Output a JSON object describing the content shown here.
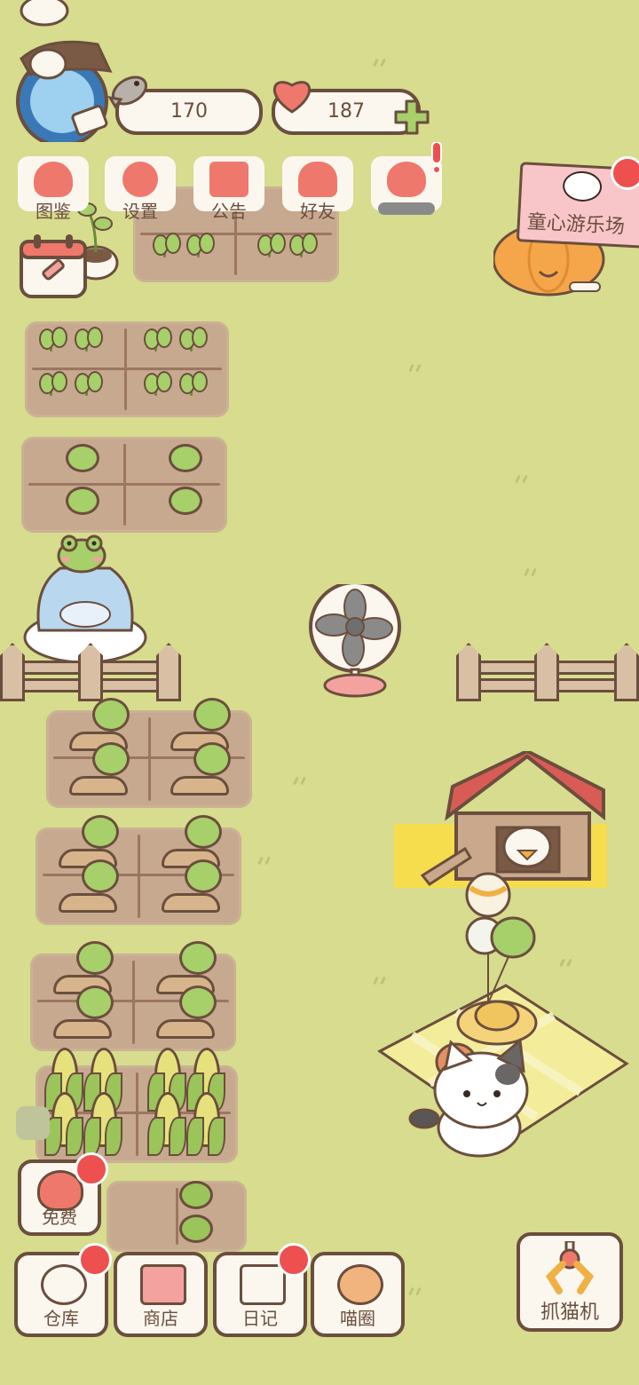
{
  "resources": {
    "fish_count": "170",
    "heart_count": "187"
  },
  "menu": [
    {
      "label": "图鉴",
      "icon": "cat-book-icon"
    },
    {
      "label": "设置",
      "icon": "gear-icon"
    },
    {
      "label": "公告",
      "icon": "gift-icon"
    },
    {
      "label": "好友",
      "icon": "friends-icon"
    },
    {
      "label": "",
      "icon": "heart-notice-icon"
    }
  ],
  "event_banner": {
    "label": "童心游乐场"
  },
  "free_button": {
    "label": "免费"
  },
  "bottom_bar": [
    {
      "label": "仓库",
      "icon": "storage-icon"
    },
    {
      "label": "商店",
      "icon": "shop-icon"
    },
    {
      "label": "日记",
      "icon": "diary-icon"
    },
    {
      "label": "喵圈",
      "icon": "cat-planet-icon"
    }
  ],
  "claw_machine": {
    "label": "抓猫机",
    "icon": "claw-icon"
  },
  "colors": {
    "grass": "#d7dc8e",
    "soil": "#c7a98f",
    "outline": "#6b4e3d",
    "accent_red": "#ee4f4f",
    "pink": "#ef786c"
  }
}
